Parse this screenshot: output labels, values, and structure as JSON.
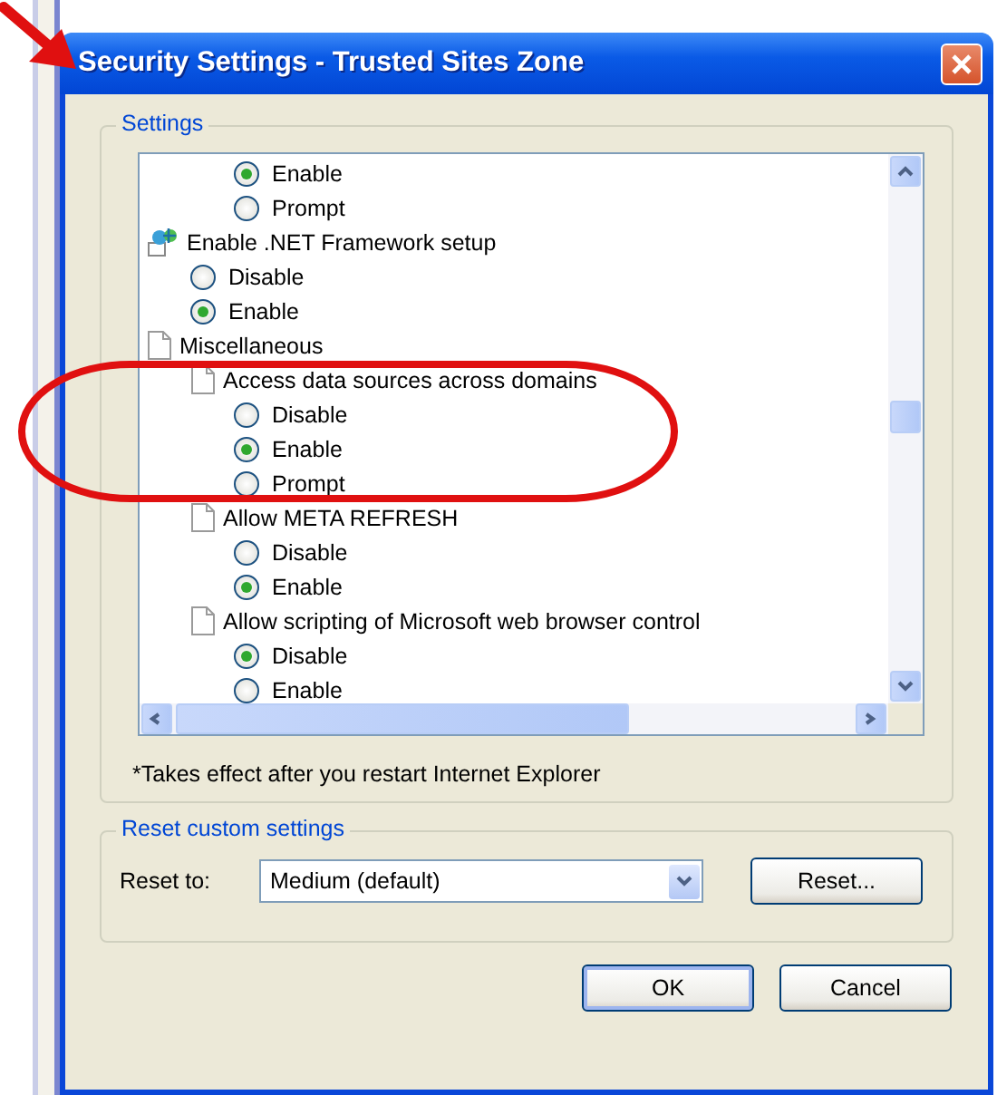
{
  "window": {
    "title": "Security Settings - Trusted Sites Zone"
  },
  "settings": {
    "label": "Settings",
    "tree": [
      {
        "kind": "continued",
        "children": [
          {
            "kind": "option",
            "label": "Enable",
            "selected": true
          },
          {
            "kind": "option",
            "label": "Prompt",
            "selected": false
          }
        ]
      },
      {
        "kind": "group",
        "label": "Enable .NET Framework setup",
        "children": [
          {
            "kind": "option",
            "label": "Disable",
            "selected": false
          },
          {
            "kind": "option",
            "label": "Enable",
            "selected": true
          }
        ]
      },
      {
        "kind": "category",
        "label": "Miscellaneous",
        "children": [
          {
            "kind": "setting",
            "label": "Access data sources across domains",
            "children": [
              {
                "kind": "option",
                "label": "Disable",
                "selected": false
              },
              {
                "kind": "option",
                "label": "Enable",
                "selected": true
              },
              {
                "kind": "option",
                "label": "Prompt",
                "selected": false
              }
            ]
          },
          {
            "kind": "setting",
            "label": "Allow META REFRESH",
            "children": [
              {
                "kind": "option",
                "label": "Disable",
                "selected": false
              },
              {
                "kind": "option",
                "label": "Enable",
                "selected": true
              }
            ]
          },
          {
            "kind": "setting",
            "label": "Allow scripting of Microsoft web browser control",
            "children": [
              {
                "kind": "option",
                "label": "Disable",
                "selected": true
              },
              {
                "kind": "option",
                "label": "Enable",
                "selected": false
              }
            ]
          }
        ]
      }
    ],
    "note": "*Takes effect after you restart Internet Explorer"
  },
  "reset": {
    "label": "Reset custom settings",
    "field_label": "Reset to:",
    "value": "Medium (default)",
    "button": "Reset..."
  },
  "buttons": [
    "OK",
    "Cancel"
  ]
}
